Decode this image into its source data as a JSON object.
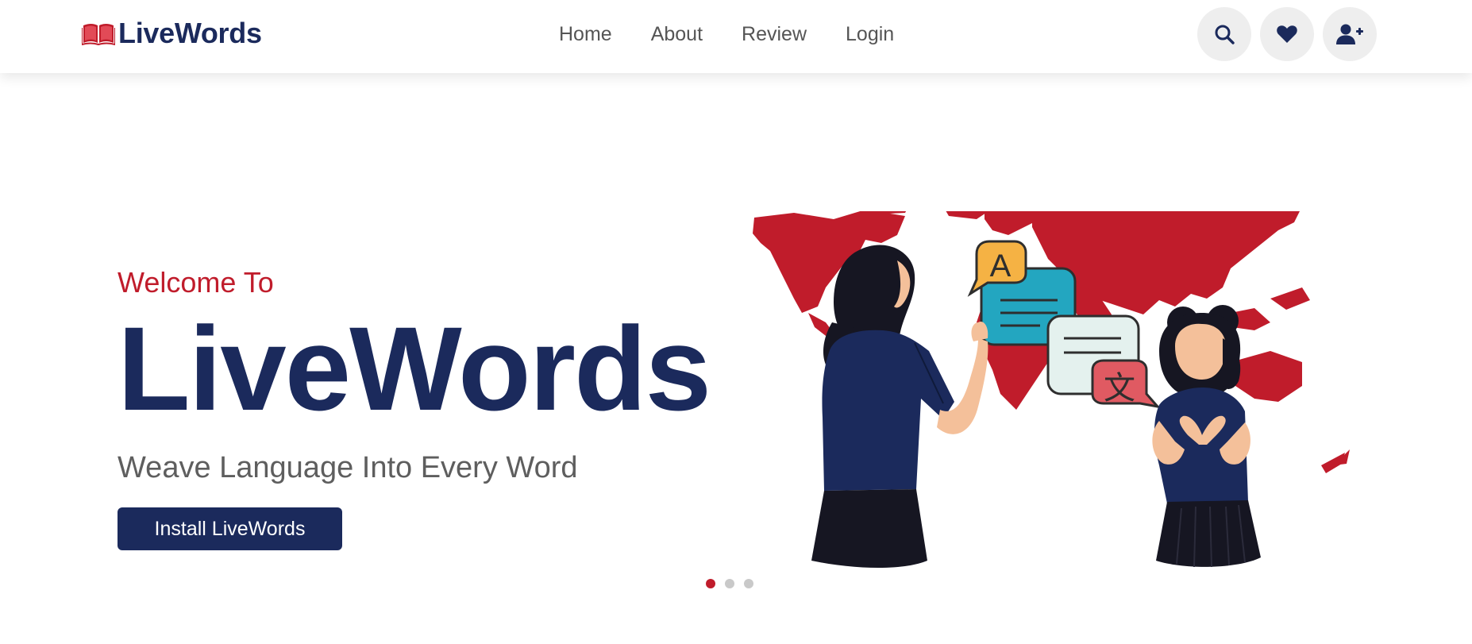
{
  "brand": {
    "name": "LiveWords",
    "primary_color": "#1b2a5c",
    "accent_color": "#c01c2b",
    "logo_icon": "open-book-icon"
  },
  "nav": {
    "items": [
      {
        "label": "Home"
      },
      {
        "label": "About"
      },
      {
        "label": "Review"
      },
      {
        "label": "Login"
      }
    ]
  },
  "header_actions": [
    {
      "icon": "search-icon"
    },
    {
      "icon": "heart-icon"
    },
    {
      "icon": "user-plus-icon"
    }
  ],
  "hero": {
    "eyebrow": "Welcome To",
    "title": "LiveWords",
    "tagline": "Weave Language Into Every Word",
    "cta_label": "Install LiveWords",
    "bubble_letter_a": "A",
    "bubble_letter_zh": "文"
  },
  "carousel": {
    "slide_count": 3,
    "active_index": 0
  }
}
